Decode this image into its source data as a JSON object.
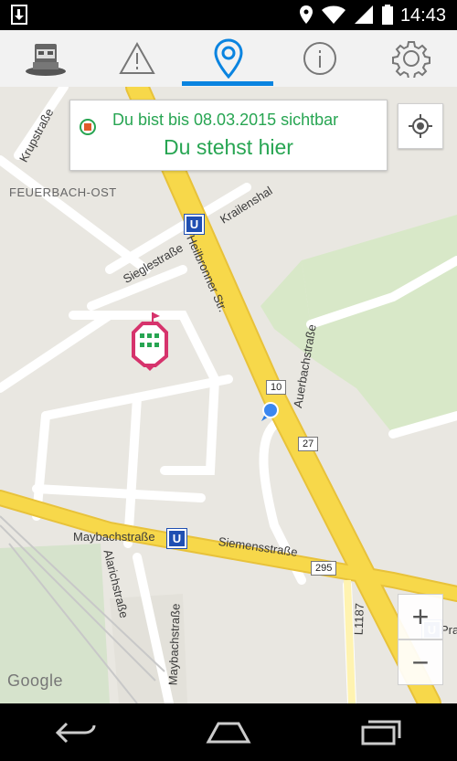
{
  "status_bar": {
    "time": "14:43",
    "icons": [
      "download-icon",
      "location-icon",
      "wifi-icon",
      "signal-icon",
      "battery-icon"
    ]
  },
  "tabs": [
    {
      "name": "profile",
      "icon": "avatar-icon",
      "selected": false
    },
    {
      "name": "alerts",
      "icon": "warning-icon",
      "selected": false
    },
    {
      "name": "map",
      "icon": "location-pin-icon",
      "selected": true
    },
    {
      "name": "info",
      "icon": "info-icon",
      "selected": false
    },
    {
      "name": "settings",
      "icon": "gear-icon",
      "selected": false
    }
  ],
  "info_card": {
    "visible_until": "Du bist bis 08.03.2015 sichtbar",
    "location_status": "Du stehst hier"
  },
  "map": {
    "district": "FEUERBACH-OST",
    "streets": {
      "krupp": "Krupstraße",
      "siegle": "Sieglestraße",
      "kraeuler": "Krailenshal",
      "heilbronner": "Heilbronner Str.",
      "auerbach": "Auerbachstraße",
      "maybach_station": "Maybachstraße",
      "siemens": "Siemensstraße",
      "alarich": "Alarichstraße",
      "maybach": "Maybachstraße",
      "l1187": "L1187",
      "pra": "Pra"
    },
    "shields": {
      "r10": "10",
      "r27": "27",
      "r295": "295"
    },
    "ubahn_symbol": "U",
    "attribution": "Google"
  },
  "controls": {
    "zoom_in": "+",
    "zoom_out": "−"
  },
  "colors": {
    "accent": "#0a84e0",
    "green": "#27a552",
    "road": "#f7d84a",
    "marker": "#d6336c"
  }
}
